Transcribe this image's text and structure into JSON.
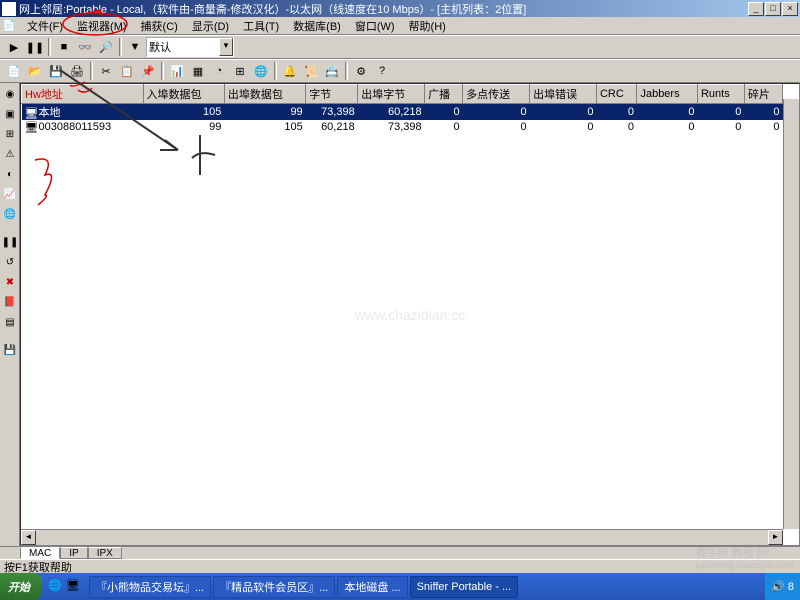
{
  "title": "网上邻居:Portable - Local,（软件由-商量斋-修改汉化）-以太网（线速度在10 Mbps）- [主机列表：2位置]",
  "menu": {
    "file": "文件(F)",
    "monitor": "监视器(M)",
    "capture": "捕获(C)",
    "display": "显示(D)",
    "tools": "工具(T)",
    "database": "数据库(B)",
    "window": "窗口(W)",
    "help": "帮助(H)"
  },
  "toolbar1": {
    "dropdown_value": "默认"
  },
  "table": {
    "headers": [
      "Hw地址",
      "入埠数据包",
      "出埠数据包",
      "字节",
      "出埠字节",
      "广播",
      "多点传送",
      "出埠错误",
      "CRC",
      "Jabbers",
      "Runts",
      "碎片"
    ],
    "rows": [
      {
        "icon": "host-icon",
        "label": "本地",
        "cells": [
          "105",
          "99",
          "73,398",
          "60,218",
          "0",
          "0",
          "0",
          "0",
          "0",
          "0",
          "0"
        ],
        "selected": true
      },
      {
        "icon": "nic-icon",
        "label": "003088011593",
        "cells": [
          "99",
          "105",
          "60,218",
          "73,398",
          "0",
          "0",
          "0",
          "0",
          "0",
          "0",
          "0"
        ],
        "selected": false
      }
    ]
  },
  "tabs": {
    "mac": "MAC",
    "ip": "IP",
    "ipx": "IPX"
  },
  "status": "按F1获取帮助",
  "taskbar": {
    "start": "开始",
    "items": [
      "『小熊物品交易坛』...",
      "『精品软件会员区』...",
      "本地磁盘 ...",
      "Sniffer Portable - ..."
    ],
    "tray_time": "8"
  },
  "watermark_main": "香字典 教程 网",
  "watermark_sub": "jiaocheng.chazidian.com",
  "watermark_center": "www.chazidian.cc"
}
